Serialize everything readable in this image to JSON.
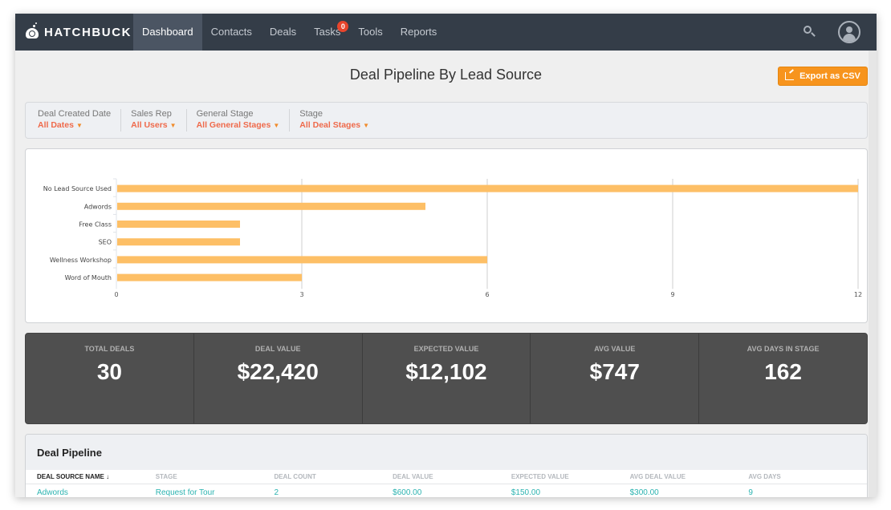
{
  "nav": {
    "brand": "HATCHBUCK",
    "items": [
      {
        "label": "Dashboard",
        "active": true
      },
      {
        "label": "Contacts"
      },
      {
        "label": "Deals"
      },
      {
        "label": "Tasks",
        "badge": "0"
      },
      {
        "label": "Tools"
      },
      {
        "label": "Reports"
      }
    ]
  },
  "page": {
    "title": "Deal Pipeline By Lead Source",
    "export_label": "Export as CSV"
  },
  "filters": [
    {
      "label": "Deal Created Date",
      "value": "All Dates"
    },
    {
      "label": "Sales Rep",
      "value": "All Users"
    },
    {
      "label": "General Stage",
      "value": "All General Stages"
    },
    {
      "label": "Stage",
      "value": "All Deal Stages"
    }
  ],
  "chart_data": {
    "type": "bar",
    "orientation": "horizontal",
    "categories": [
      "No Lead Source Used",
      "Adwords",
      "Free Class",
      "SEO",
      "Wellness Workshop",
      "Word of Mouth"
    ],
    "values": [
      12,
      5,
      2,
      2,
      6,
      3
    ],
    "xlim": [
      0,
      12
    ],
    "xticks": [
      0,
      3,
      6,
      9,
      12
    ],
    "grid": true,
    "color": "#fdbf66",
    "title": "",
    "xlabel": "",
    "ylabel": ""
  },
  "stats": [
    {
      "label": "TOTAL DEALS",
      "value": "30"
    },
    {
      "label": "DEAL VALUE",
      "value": "$22,420"
    },
    {
      "label": "EXPECTED VALUE",
      "value": "$12,102"
    },
    {
      "label": "AVG VALUE",
      "value": "$747"
    },
    {
      "label": "AVG DAYS IN STAGE",
      "value": "162"
    }
  ],
  "table": {
    "title": "Deal Pipeline",
    "columns": [
      "DEAL SOURCE NAME ↓",
      "STAGE",
      "DEAL COUNT",
      "DEAL VALUE",
      "EXPECTED VALUE",
      "AVG DEAL VALUE",
      "AVG DAYS"
    ],
    "rows": [
      [
        "Adwords",
        "Request for Tour",
        "2",
        "$600.00",
        "$150.00",
        "$300.00",
        "9"
      ]
    ]
  }
}
